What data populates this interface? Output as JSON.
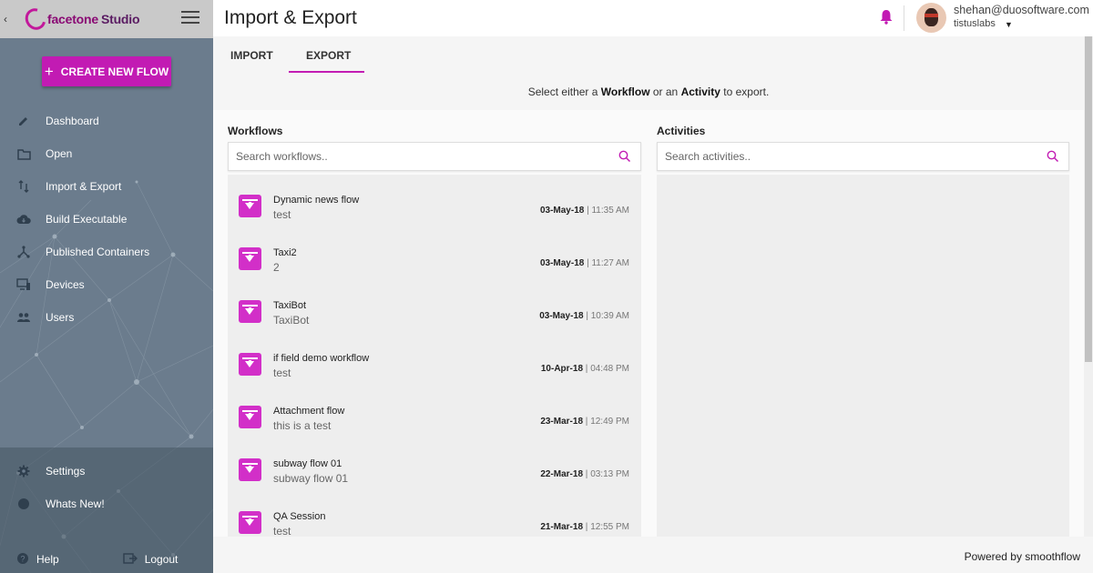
{
  "app": {
    "logo_brand": "facetone",
    "logo_suffix": "Studio",
    "back_glyph": "‹",
    "accent_color": "#c21bb3"
  },
  "sidebar": {
    "create_button": "CREATE NEW FLOW",
    "items": [
      {
        "label": "Dashboard",
        "icon": "pencil-icon"
      },
      {
        "label": "Open",
        "icon": "folder-icon"
      },
      {
        "label": "Import & Export",
        "icon": "import-export-icon"
      },
      {
        "label": "Build Executable",
        "icon": "cloud-download-icon"
      },
      {
        "label": "Published Containers",
        "icon": "hub-icon"
      },
      {
        "label": "Devices",
        "icon": "devices-icon"
      },
      {
        "label": "Users",
        "icon": "users-icon"
      }
    ],
    "bottom_items": [
      {
        "label": "Settings",
        "icon": "gear-icon"
      },
      {
        "label": "Whats New!",
        "icon": "star-badge-icon"
      }
    ],
    "help_label": "Help",
    "logout_label": "Logout"
  },
  "header": {
    "title": "Import & Export",
    "user_email": "shehan@duosoftware.com",
    "user_org": "tistuslabs"
  },
  "tabs": [
    {
      "label": "IMPORT",
      "active": false
    },
    {
      "label": "EXPORT",
      "active": true
    }
  ],
  "instruction": {
    "prefix": "Select either a ",
    "workflow": "Workflow",
    "middle": " or an ",
    "activity": "Activity",
    "suffix": " to export."
  },
  "workflows": {
    "title": "Workflows",
    "search_placeholder": "Search workflows..",
    "items": [
      {
        "name": "Dynamic news flow",
        "desc": "test",
        "date": "03-May-18",
        "time": "11:35 AM"
      },
      {
        "name": "Taxi2",
        "desc": "2",
        "date": "03-May-18",
        "time": "11:27 AM"
      },
      {
        "name": "TaxiBot",
        "desc": "TaxiBot",
        "date": "03-May-18",
        "time": "10:39 AM"
      },
      {
        "name": "if field demo workflow",
        "desc": "test",
        "date": "10-Apr-18",
        "time": "04:48 PM"
      },
      {
        "name": "Attachment flow",
        "desc": "this is a test",
        "date": "23-Mar-18",
        "time": "12:49 PM"
      },
      {
        "name": "subway flow 01",
        "desc": "subway flow 01",
        "date": "22-Mar-18",
        "time": "03:13 PM"
      },
      {
        "name": "QA Session",
        "desc": "test",
        "date": "21-Mar-18",
        "time": "12:55 PM"
      }
    ]
  },
  "activities": {
    "title": "Activities",
    "search_placeholder": "Search activities.."
  },
  "footer": {
    "powered_by": "Powered by smoothflow"
  }
}
